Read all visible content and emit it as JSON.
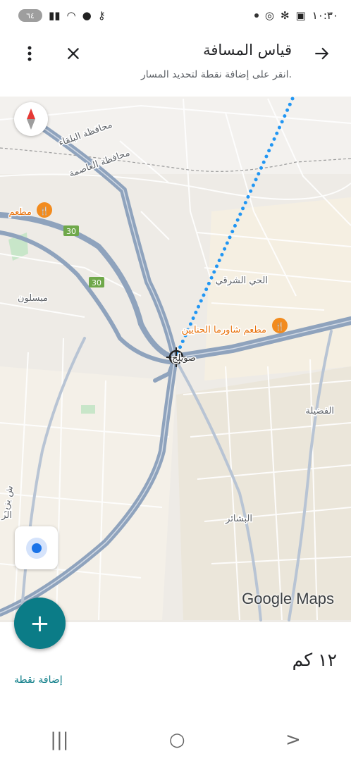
{
  "status_bar": {
    "time": "١٠:٣٠",
    "battery": "٦٤",
    "left_icons": [
      "battery-icon",
      "signal-icon",
      "wifi-icon",
      "location-icon",
      "key-icon"
    ],
    "right_icons": [
      "notification-dot-icon",
      "shield-icon",
      "fan-icon",
      "screenshot-icon"
    ]
  },
  "header": {
    "title": "قياس المسافة",
    "subtitle": "انقر على إضافة نقطة لتحديد المسار."
  },
  "map": {
    "labels": {
      "governorate_balqa": "محافظة البلقاء",
      "governorate_capital": "محافظة العاصمة",
      "restaurant_left": "مطعم",
      "route_30_a": "30",
      "route_30_b": "30",
      "district_east": "الحي الشرقي",
      "maysaloun": "ميسلون",
      "restaurant_shawarma": "مطعم شاورما الحنايين",
      "center": "صويلح",
      "fudayla": "الفضيلة",
      "left_edge_1": "ش يزيد",
      "left_edge_2": "الر",
      "bashair": "البشائر"
    },
    "logo": "Google Maps",
    "colors": {
      "map_bg": "#eeebe6",
      "road": "#8fa3bd",
      "route": "#2196f3",
      "poi": "#f28b1e"
    }
  },
  "bottom": {
    "fab_label": "+",
    "distance": "١٢ كم",
    "add_point": "إضافة نقطة"
  },
  "nav_bar": {
    "recents": "|||",
    "home": "○",
    "back": ">"
  }
}
